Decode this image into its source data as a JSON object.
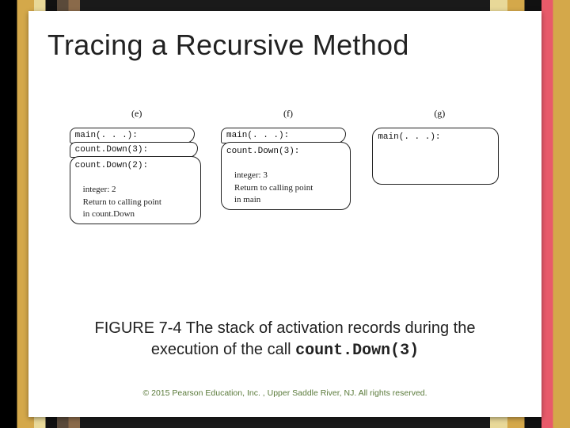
{
  "title": "Tracing a Recursive Method",
  "columns": {
    "e": {
      "label": "(e)"
    },
    "f": {
      "label": "(f)"
    },
    "g": {
      "label": "(g)"
    }
  },
  "frames": {
    "main": "main(. . .):",
    "cd3": "count.Down(3):",
    "cd2": "count.Down(2):",
    "int2": "integer: 2",
    "ret_cd": "Return to calling point",
    "in_cd": "in count.Down",
    "int3": "integer: 3",
    "ret_main": "Return to calling point",
    "in_main": "in main"
  },
  "caption": {
    "line1": "FIGURE 7-4 The stack of activation records during the",
    "line2_pre": "execution of the call ",
    "line2_code": "count.Down(3)"
  },
  "copyright": "© 2015 Pearson Education, Inc. , Upper Saddle River, NJ.  All rights reserved."
}
